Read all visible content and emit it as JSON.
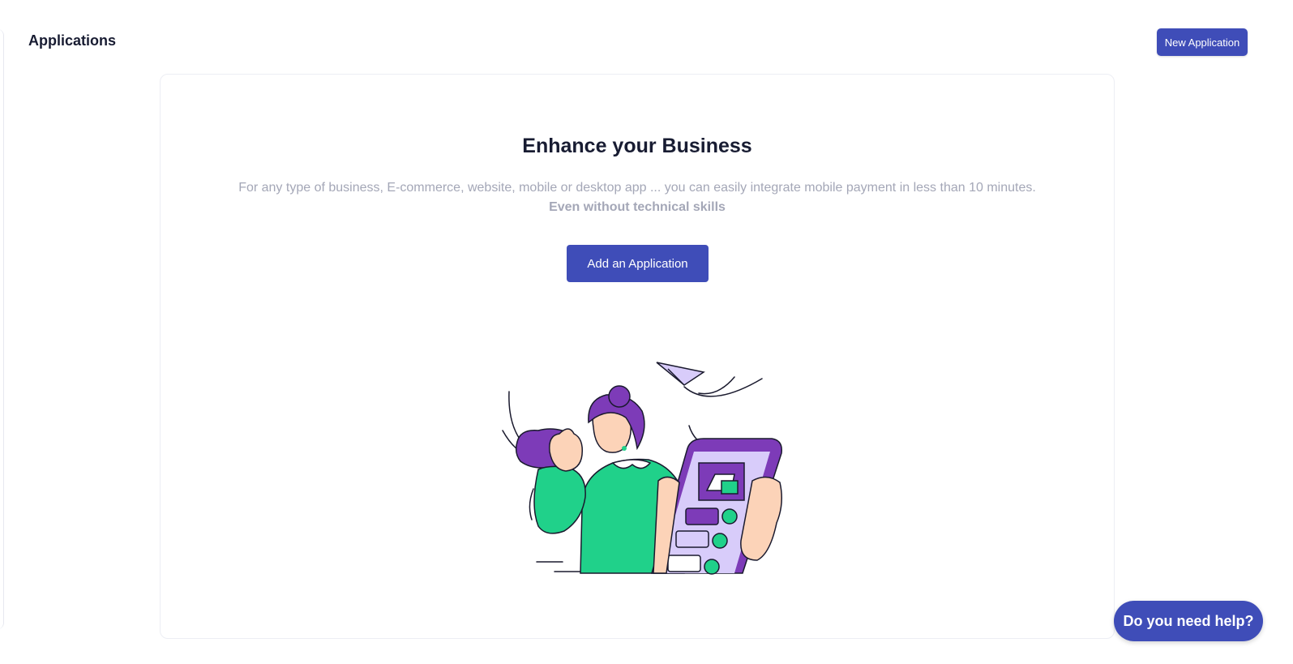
{
  "header": {
    "title": "Applications",
    "new_button_label": "New Application"
  },
  "hero": {
    "title": "Enhance your Business",
    "description": "For any type of business, E-commerce, website, mobile or desktop app ... you can easily integrate mobile payment in less than 10 minutes.",
    "description_strong": "Even without technical skills",
    "cta_label": "Add an Application"
  },
  "help": {
    "label": "Do you need help?"
  },
  "colors": {
    "primary": "#3f4db8",
    "muted_text": "#a4a7b7",
    "illustration_purple": "#7d3bb8",
    "illustration_green": "#20d18a",
    "illustration_lavender": "#d8ccfa"
  },
  "illustration": {
    "icon": "woman-holding-phone-illustration"
  }
}
